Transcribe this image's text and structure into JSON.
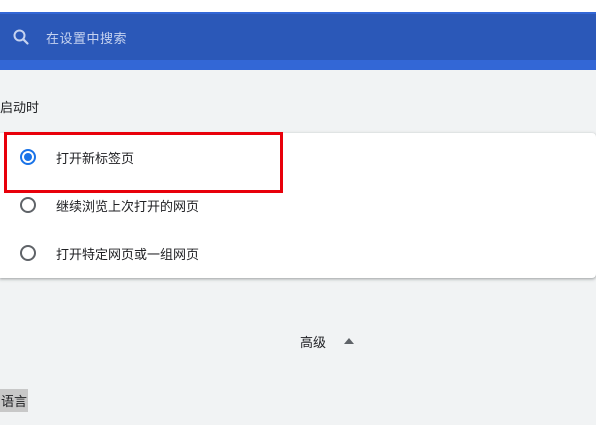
{
  "search": {
    "placeholder": "在设置中搜索",
    "icon": "search-icon"
  },
  "startup": {
    "title": "启动时",
    "options": [
      {
        "label": "打开新标签页",
        "checked": true
      },
      {
        "label": "继续浏览上次打开的网页",
        "checked": false
      },
      {
        "label": "打开特定网页或一组网页",
        "checked": false
      }
    ]
  },
  "advanced": {
    "label": "高级",
    "icon": "triangle-up-icon"
  },
  "language": {
    "label": "语言"
  },
  "colors": {
    "header_blue": "#3367d6",
    "search_blue": "#2b58b8",
    "radio_checked": "#1a73e8",
    "highlight_red": "#e8000a"
  }
}
